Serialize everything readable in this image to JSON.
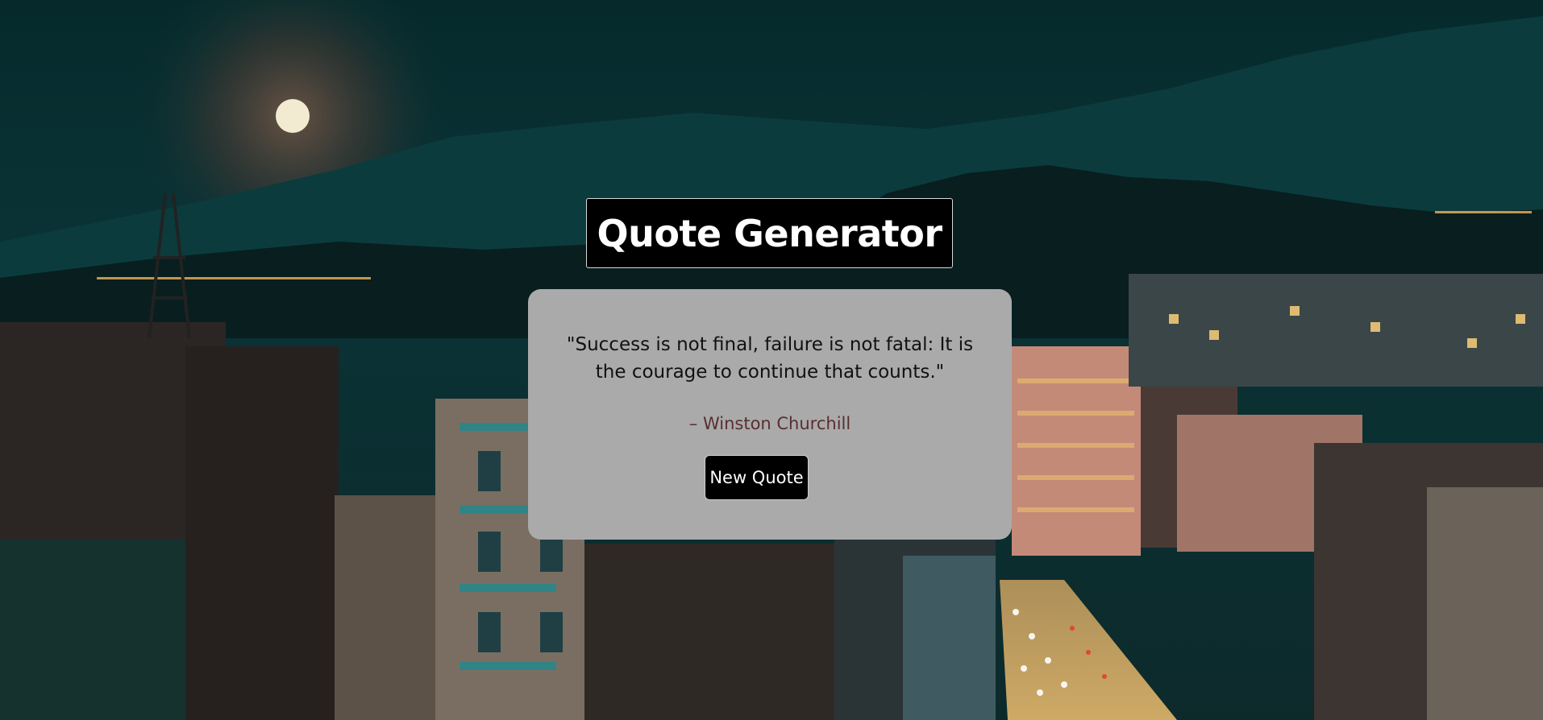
{
  "header": {
    "title": "Quote Generator"
  },
  "quote": {
    "text": "\"Success is not final, failure is not fatal: It is the courage to continue that counts.\"",
    "author": "– Winston Churchill"
  },
  "actions": {
    "new_quote_label": "New Quote"
  },
  "colors": {
    "card_background": "#aaaaaa",
    "title_background": "#000000",
    "button_background": "#000000",
    "author_text": "#5a2e32"
  },
  "background": {
    "scene": "night city skyline with full moon over mountains"
  }
}
